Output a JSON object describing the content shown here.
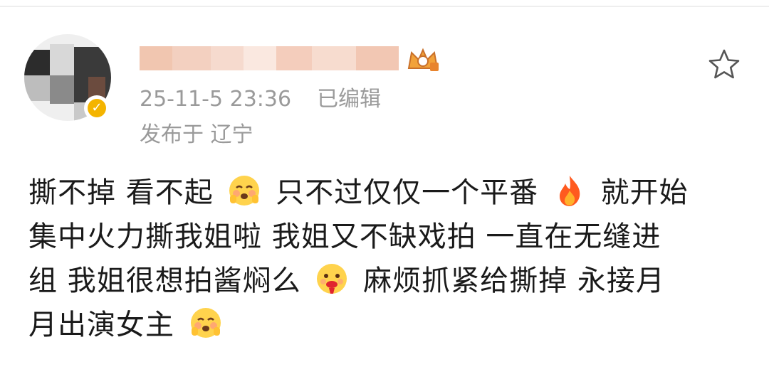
{
  "post": {
    "timestamp": "25-11-5 23:36",
    "edited_label": "已编辑",
    "location": "发布于 辽宁",
    "lines": [
      [
        {
          "text": "撕不掉 看不起",
          "highlight": false
        },
        {
          "emoji": "blush-face-emoji"
        },
        {
          "text": "只不过仅仅一个平番",
          "highlight": true
        },
        {
          "emoji": "fire-emoji"
        },
        {
          "text": "就开始",
          "highlight": true
        }
      ],
      [
        {
          "text": "集中火力撕我姐啦",
          "highlight": true
        },
        {
          "text": "我姐又不缺戏拍 一直在无缝进",
          "highlight": false
        }
      ],
      [
        {
          "text": "组 我姐很想拍酱焖么",
          "highlight": false
        },
        {
          "emoji": "lipstick-face-emoji"
        },
        {
          "text": "麻烦抓紧给撕掉 永接月",
          "highlight": false
        }
      ],
      [
        {
          "text": "月出演女主",
          "highlight": false
        },
        {
          "emoji": "blush-face-emoji"
        }
      ]
    ],
    "colors": {
      "highlight": "#f0583c",
      "meta_text": "#9a9a9a",
      "body_text": "#1a1a1a",
      "verify_badge": "#f4b400"
    }
  }
}
